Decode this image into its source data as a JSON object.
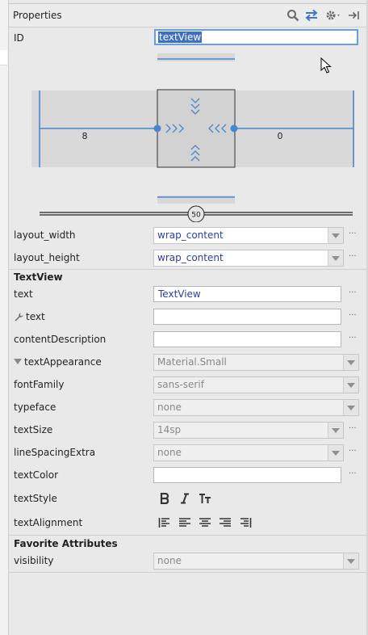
{
  "header": {
    "title": "Properties"
  },
  "id_field": {
    "label": "ID",
    "value": "textView"
  },
  "constraints": {
    "left_margin": "8",
    "right_margin": "0",
    "bias": "50"
  },
  "layout": [
    {
      "label": "layout_width",
      "value": "wrap_content"
    },
    {
      "label": "layout_height",
      "value": "wrap_content"
    }
  ],
  "textview_section": {
    "title": "TextView",
    "text": {
      "label": "text",
      "value": "TextView"
    },
    "tools_text": {
      "label": "text",
      "value": ""
    },
    "content_description": {
      "label": "contentDescription",
      "value": ""
    },
    "text_appearance": {
      "label": "textAppearance",
      "value": "Material.Small"
    },
    "font_family": {
      "label": "fontFamily",
      "value": "sans-serif"
    },
    "typeface": {
      "label": "typeface",
      "value": "none"
    },
    "text_size": {
      "label": "textSize",
      "value": "14sp"
    },
    "line_spacing": {
      "label": "lineSpacingExtra",
      "value": "none"
    },
    "text_color": {
      "label": "textColor",
      "value": ""
    },
    "text_style": {
      "label": "textStyle"
    },
    "text_alignment": {
      "label": "textAlignment"
    }
  },
  "favorites": {
    "title": "Favorite Attributes",
    "visibility": {
      "label": "visibility",
      "value": "none"
    }
  },
  "more_glyph": "···",
  "colors": {
    "accent": "#4a86d0",
    "value_text": "#2a3fa9"
  }
}
